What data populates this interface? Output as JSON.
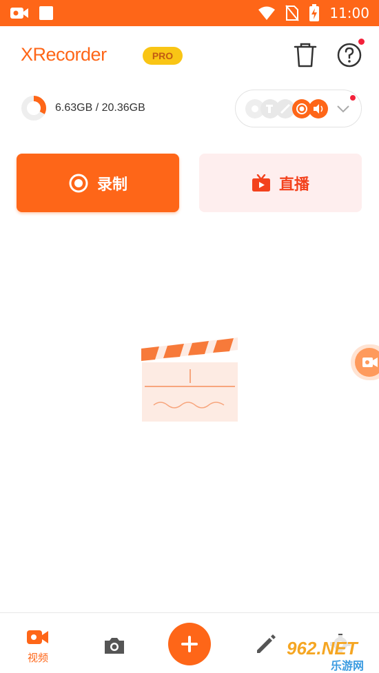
{
  "status_bar": {
    "time": "11:00",
    "icons": [
      "video-camera-icon",
      "square-icon",
      "wifi-icon",
      "no-sim-icon",
      "battery-charging-icon"
    ]
  },
  "header": {
    "app_name": "XRecorder",
    "badge": "PRO",
    "icons": [
      "trash-icon",
      "help-icon"
    ]
  },
  "storage": {
    "text": "6.63GB / 20.36GB",
    "used_fraction": 0.33
  },
  "source_selector": {
    "icons": [
      "camera-icon",
      "brush-icon",
      "pencil-icon",
      "record-icon",
      "audio-icon"
    ],
    "expand_icon": "chevron-down-icon"
  },
  "actions": {
    "record_label": "录制",
    "live_label": "直播"
  },
  "bottom_nav": {
    "videos_label": "视频",
    "items": [
      "video-camera-icon",
      "camera-icon",
      "plus-icon",
      "pencil-icon",
      "gear-icon"
    ]
  },
  "watermark": {
    "text_top": "962.NET",
    "text_bottom": "乐游网"
  },
  "colors": {
    "brand": "#fe6618",
    "badge": "#f9c515",
    "live_bg": "#feeeee",
    "live_text": "#f3421d",
    "notice": "#f3213a"
  }
}
